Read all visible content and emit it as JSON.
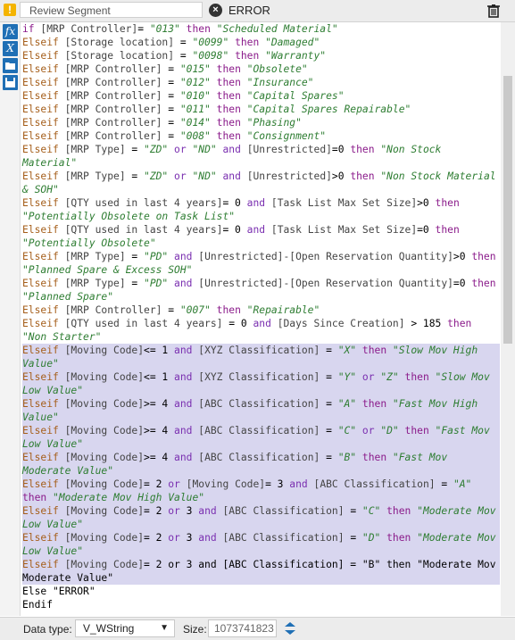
{
  "header": {
    "field_name": "Review Segment",
    "output_text": "ERROR"
  },
  "sidebar": {
    "icons": [
      "fx-icon",
      "x-variable-icon",
      "open-folder-icon",
      "save-icon"
    ]
  },
  "code_lines": [
    [
      [
        "kw",
        "if "
      ],
      [
        "field",
        "[MRP Controller]"
      ],
      [
        "dflt",
        "= "
      ],
      [
        "str",
        "\"013\""
      ],
      [
        "kw",
        " then "
      ],
      [
        "str",
        "\"Scheduled Material\""
      ]
    ],
    [
      [
        "el",
        "Elseif "
      ],
      [
        "field",
        "[Storage location]"
      ],
      [
        "dflt",
        " = "
      ],
      [
        "str",
        "\"0099\""
      ],
      [
        "kw",
        " then "
      ],
      [
        "str",
        "\"Damaged\""
      ]
    ],
    [
      [
        "el",
        "Elseif "
      ],
      [
        "field",
        "[Storage location]"
      ],
      [
        "dflt",
        " = "
      ],
      [
        "str",
        "\"0098\""
      ],
      [
        "kw",
        " then "
      ],
      [
        "str",
        "\"Warranty\""
      ]
    ],
    [
      [
        "el",
        "Elseif "
      ],
      [
        "field",
        "[MRP Controller]"
      ],
      [
        "dflt",
        " = "
      ],
      [
        "str",
        "\"015\""
      ],
      [
        "kw",
        " then "
      ],
      [
        "str",
        "\"Obsolete\""
      ]
    ],
    [
      [
        "el",
        "Elseif "
      ],
      [
        "field",
        "[MRP Controller]"
      ],
      [
        "dflt",
        " = "
      ],
      [
        "str",
        "\"012\""
      ],
      [
        "kw",
        " then "
      ],
      [
        "str",
        "\"Insurance\""
      ]
    ],
    [
      [
        "el",
        "Elseif "
      ],
      [
        "field",
        "[MRP Controller]"
      ],
      [
        "dflt",
        " = "
      ],
      [
        "str",
        "\"010\""
      ],
      [
        "kw",
        " then "
      ],
      [
        "str",
        "\"Capital Spares\""
      ]
    ],
    [
      [
        "el",
        "Elseif "
      ],
      [
        "field",
        "[MRP Controller]"
      ],
      [
        "dflt",
        " = "
      ],
      [
        "str",
        "\"011\""
      ],
      [
        "kw",
        " then "
      ],
      [
        "str",
        "\"Capital Spares Repairable\""
      ]
    ],
    [
      [
        "el",
        "Elseif "
      ],
      [
        "field",
        "[MRP Controller]"
      ],
      [
        "dflt",
        " = "
      ],
      [
        "str",
        "\"014\""
      ],
      [
        "kw",
        " then "
      ],
      [
        "str",
        "\"Phasing\""
      ]
    ],
    [
      [
        "el",
        "Elseif "
      ],
      [
        "field",
        "[MRP Controller]"
      ],
      [
        "dflt",
        " = "
      ],
      [
        "str",
        "\"008\""
      ],
      [
        "kw",
        " then "
      ],
      [
        "str",
        "\"Consignment\""
      ]
    ],
    [
      [
        "el",
        "Elseif "
      ],
      [
        "field",
        "[MRP Type]"
      ],
      [
        "dflt",
        " = "
      ],
      [
        "str",
        "\"ZD\""
      ],
      [
        "kw2",
        " or "
      ],
      [
        "str",
        "\"ND\""
      ],
      [
        "kw2",
        " and "
      ],
      [
        "field",
        "[Unrestricted]"
      ],
      [
        "dflt",
        "=0"
      ],
      [
        "kw",
        " then "
      ],
      [
        "str",
        "\"Non Stock Material\""
      ]
    ],
    [
      [
        "el",
        "Elseif "
      ],
      [
        "field",
        "[MRP Type]"
      ],
      [
        "dflt",
        " = "
      ],
      [
        "str",
        "\"ZD\""
      ],
      [
        "kw2",
        " or "
      ],
      [
        "str",
        "\"ND\""
      ],
      [
        "kw2",
        " and "
      ],
      [
        "field",
        "[Unrestricted]"
      ],
      [
        "dflt",
        ">0"
      ],
      [
        "kw",
        " then "
      ],
      [
        "str",
        "\"Non Stock Material & SOH\""
      ]
    ],
    [
      [
        "el",
        "Elseif "
      ],
      [
        "field",
        "[QTY used in last 4 years]"
      ],
      [
        "dflt",
        "= 0 "
      ],
      [
        "kw2",
        "and "
      ],
      [
        "field",
        "[Task List Max Set Size]"
      ],
      [
        "dflt",
        ">0"
      ],
      [
        "kw",
        " then "
      ],
      [
        "str",
        "\"Potentially Obsolete on Task List\""
      ]
    ],
    [
      [
        "el",
        "Elseif "
      ],
      [
        "field",
        "[QTY used in last 4 years]"
      ],
      [
        "dflt",
        "= 0 "
      ],
      [
        "kw2",
        "and "
      ],
      [
        "field",
        "[Task List Max Set Size]"
      ],
      [
        "dflt",
        "=0"
      ],
      [
        "kw",
        " then "
      ],
      [
        "str",
        "\"Potentially Obsolete\""
      ]
    ],
    [
      [
        "el",
        "Elseif "
      ],
      [
        "field",
        "[MRP Type]"
      ],
      [
        "dflt",
        " = "
      ],
      [
        "str",
        "\"PD\""
      ],
      [
        "kw2",
        " and "
      ],
      [
        "field",
        "[Unrestricted]-[Open Reservation Quantity]"
      ],
      [
        "dflt",
        ">0"
      ],
      [
        "kw",
        " then "
      ],
      [
        "str",
        "\"Planned Spare & Excess SOH\""
      ]
    ],
    [
      [
        "el",
        "Elseif "
      ],
      [
        "field",
        "[MRP Type]"
      ],
      [
        "dflt",
        " = "
      ],
      [
        "str",
        "\"PD\""
      ],
      [
        "kw2",
        " and "
      ],
      [
        "field",
        "[Unrestricted]-[Open Reservation Quantity]"
      ],
      [
        "dflt",
        "=0"
      ],
      [
        "kw",
        " then "
      ],
      [
        "str",
        "\"Planned Spare\""
      ]
    ],
    [
      [
        "el",
        "Elseif "
      ],
      [
        "field",
        "[MRP Controller]"
      ],
      [
        "dflt",
        " = "
      ],
      [
        "str",
        "\"007\""
      ],
      [
        "kw",
        " then "
      ],
      [
        "str",
        "\"Repairable\""
      ]
    ],
    [
      [
        "el",
        "Elseif "
      ],
      [
        "field",
        "[QTY used in last 4 years]"
      ],
      [
        "dflt",
        " = 0 "
      ],
      [
        "kw2",
        "and "
      ],
      [
        "field",
        "[Days Since Creation]"
      ],
      [
        "dflt",
        " > 185 "
      ],
      [
        "kw",
        "then "
      ],
      [
        "str",
        "\"Non Starter\""
      ]
    ],
    [
      [
        "el",
        "Elseif "
      ],
      [
        "field",
        "[Moving Code]"
      ],
      [
        "dflt",
        "<= 1 "
      ],
      [
        "kw2",
        "and "
      ],
      [
        "field",
        "[XYZ Classification]"
      ],
      [
        "dflt",
        " = "
      ],
      [
        "str",
        "\"X\""
      ],
      [
        "kw",
        " then "
      ],
      [
        "str",
        "\"Slow Mov High Value\""
      ]
    ],
    [
      [
        "el",
        "Elseif "
      ],
      [
        "field",
        "[Moving Code]"
      ],
      [
        "dflt",
        "<= 1 "
      ],
      [
        "kw2",
        "and "
      ],
      [
        "field",
        "[XYZ Classification]"
      ],
      [
        "dflt",
        " = "
      ],
      [
        "str",
        "\"Y\""
      ],
      [
        "kw2",
        " or "
      ],
      [
        "str",
        "\"Z\""
      ],
      [
        "kw",
        " then "
      ],
      [
        "str",
        "\"Slow Mov Low Value\""
      ]
    ],
    [
      [
        "el",
        "Elseif "
      ],
      [
        "field",
        "[Moving Code]"
      ],
      [
        "dflt",
        ">= 4 "
      ],
      [
        "kw2",
        "and "
      ],
      [
        "field",
        "[ABC Classification]"
      ],
      [
        "dflt",
        " = "
      ],
      [
        "str",
        "\"A\""
      ],
      [
        "kw",
        " then "
      ],
      [
        "str",
        "\"Fast Mov High Value\""
      ]
    ],
    [
      [
        "el",
        "Elseif "
      ],
      [
        "field",
        "[Moving Code]"
      ],
      [
        "dflt",
        ">= 4 "
      ],
      [
        "kw2",
        "and "
      ],
      [
        "field",
        "[ABC Classification]"
      ],
      [
        "dflt",
        " = "
      ],
      [
        "str",
        "\"C\""
      ],
      [
        "kw2",
        " or "
      ],
      [
        "str",
        "\"D\""
      ],
      [
        "kw",
        " then "
      ],
      [
        "str",
        "\"Fast Mov Low Value\""
      ]
    ],
    [
      [
        "el",
        "Elseif "
      ],
      [
        "field",
        "[Moving Code]"
      ],
      [
        "dflt",
        ">= 4 "
      ],
      [
        "kw2",
        "and "
      ],
      [
        "field",
        "[ABC Classification]"
      ],
      [
        "dflt",
        " = "
      ],
      [
        "str",
        "\"B\""
      ],
      [
        "kw",
        " then "
      ],
      [
        "str",
        "\"Fast Mov Moderate Value\""
      ]
    ],
    [
      [
        "el",
        "Elseif "
      ],
      [
        "field",
        "[Moving Code]"
      ],
      [
        "dflt",
        "= 2 "
      ],
      [
        "kw2",
        "or "
      ],
      [
        "field",
        "[Moving Code]"
      ],
      [
        "dflt",
        "= 3 "
      ],
      [
        "kw2",
        "and "
      ],
      [
        "field",
        "[ABC Classification]"
      ],
      [
        "dflt",
        " = "
      ],
      [
        "str",
        "\"A\""
      ],
      [
        "kw",
        " then "
      ],
      [
        "str",
        "\"Moderate Mov High Value\""
      ]
    ],
    [
      [
        "el",
        "Elseif "
      ],
      [
        "field",
        "[Moving Code]"
      ],
      [
        "dflt",
        "= 2 "
      ],
      [
        "kw2",
        "or "
      ],
      [
        "dflt",
        "3 "
      ],
      [
        "kw2",
        "and "
      ],
      [
        "field",
        "[ABC Classification]"
      ],
      [
        "dflt",
        " = "
      ],
      [
        "str",
        "\"C\""
      ],
      [
        "kw",
        " then "
      ],
      [
        "str",
        "\"Moderate Mov Low Value\""
      ]
    ],
    [
      [
        "el",
        "Elseif "
      ],
      [
        "field",
        "[Moving Code]"
      ],
      [
        "dflt",
        "= 2 "
      ],
      [
        "kw2",
        "or "
      ],
      [
        "dflt",
        "3 "
      ],
      [
        "kw2",
        "and "
      ],
      [
        "field",
        "[ABC Classification]"
      ],
      [
        "dflt",
        " = "
      ],
      [
        "str",
        "\"D\""
      ],
      [
        "kw",
        " then "
      ],
      [
        "str",
        "\"Moderate Mov Low Value\""
      ]
    ],
    [
      [
        "el",
        "Elseif "
      ],
      [
        "field",
        "[Moving Code]"
      ],
      [
        "dflt",
        "= 2 or 3 and [ABC Classification] = \"B\" then \"Moderate Mov Moderate Value\""
      ]
    ],
    [
      [
        "dflt",
        "Else \"ERROR\""
      ]
    ],
    [
      [
        "dflt",
        "Endif"
      ]
    ]
  ],
  "selection": {
    "from_line": 17,
    "to_line": 25
  },
  "footer": {
    "data_type_label": "Data type:",
    "data_type_value": "V_WString",
    "size_label": "Size:",
    "size_value": "1073741823"
  }
}
